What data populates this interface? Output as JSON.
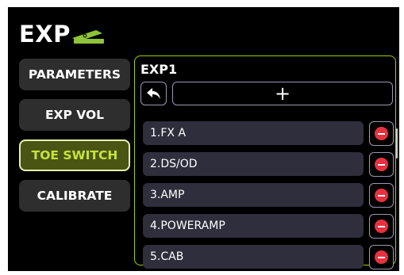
{
  "header": {
    "title": "EXP",
    "icon": "expression-pedal-icon",
    "icon_color": "#8fc33a"
  },
  "sidebar": {
    "tabs": [
      {
        "label": "PARAMETERS",
        "active": false
      },
      {
        "label": "EXP VOL",
        "active": false
      },
      {
        "label": "TOE SWITCH",
        "active": true
      },
      {
        "label": "CALIBRATE",
        "active": false
      }
    ]
  },
  "panel": {
    "title": "EXP1",
    "back_icon": "back-arrow-icon",
    "add_label": "+",
    "remove_icon": "minus-circle-icon",
    "items": [
      {
        "label": "1.FX A"
      },
      {
        "label": "2.DS/OD"
      },
      {
        "label": "3.AMP"
      },
      {
        "label": "4.POWERAMP"
      },
      {
        "label": "5.CAB"
      }
    ]
  },
  "colors": {
    "accent": "#9bd000",
    "active_tab_text": "#c5e43a",
    "active_tab_bg": "#4a5514",
    "remove": "#e8313f"
  }
}
